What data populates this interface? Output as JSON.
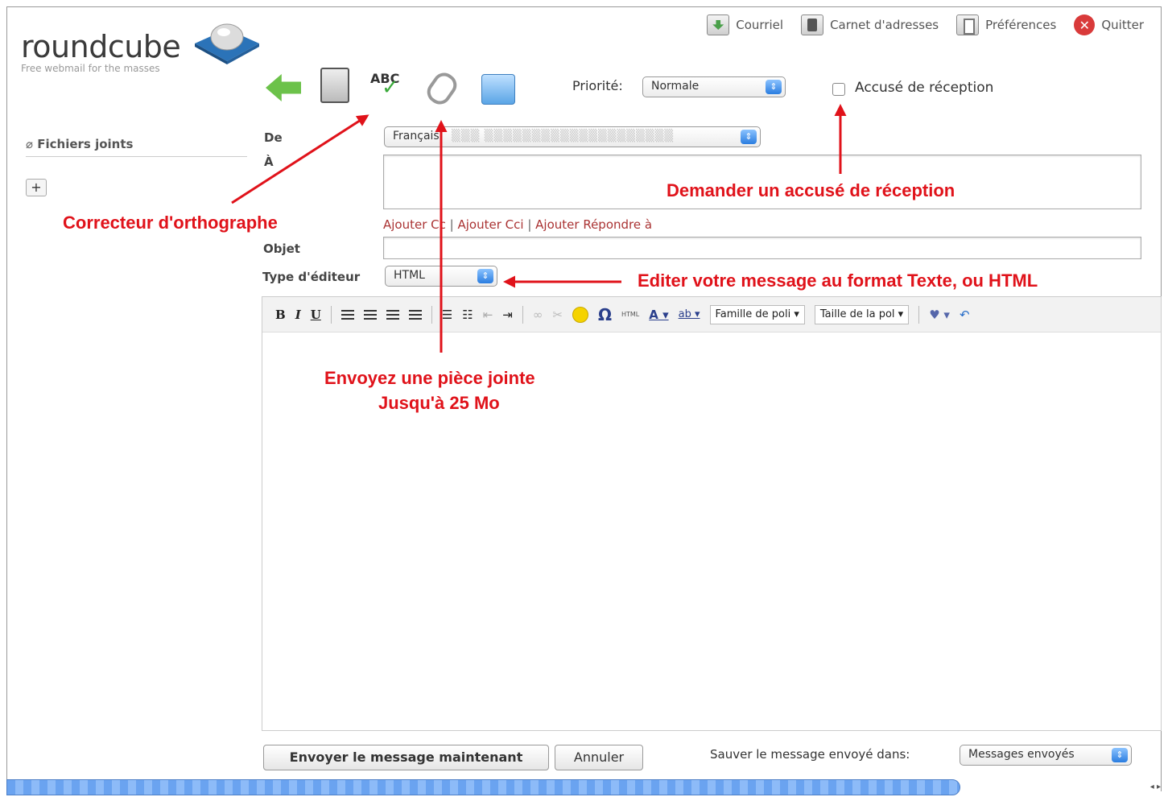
{
  "nav": {
    "mail": "Courriel",
    "contacts": "Carnet d'adresses",
    "prefs": "Préférences",
    "quit": "Quitter"
  },
  "logo": {
    "name": "roundcube",
    "tagline": "Free webmail for the masses"
  },
  "sidebar": {
    "attachments_label": "Fichiers joints",
    "add_label": "+"
  },
  "compose": {
    "priority_label": "Priorité:",
    "priority_value": "Normale",
    "receipt_label": "Accusé de réception",
    "from_label": "De",
    "from_value": "Français",
    "to_label": "À",
    "add_cc": "Ajouter Cc",
    "add_bcc": "Ajouter Cci",
    "add_reply": "Ajouter Répondre à",
    "subject_label": "Objet",
    "editor_label": "Type d'éditeur",
    "editor_value": "HTML",
    "spell_icon_text": "ABC"
  },
  "editor_toolbar": {
    "bold": "B",
    "italic": "I",
    "underline": "U",
    "html": "HTML",
    "font_family": "Famille de poli",
    "font_size": "Taille de la pol"
  },
  "footer": {
    "send": "Envoyer le message maintenant",
    "cancel": "Annuler",
    "save_in_label": "Sauver le message envoyé dans:",
    "save_in_value": "Messages envoyés"
  },
  "annotations": {
    "spell": "Correcteur d'orthographe",
    "receipt": "Demander un accusé de réception",
    "format": "Editer votre message au format Texte, ou HTML",
    "attach_line1": "Envoyez une pièce jointe",
    "attach_line2": "Jusqu'à 25 Mo"
  },
  "colors": {
    "annotation": "#e0121a",
    "accent": "#2a7de0"
  }
}
